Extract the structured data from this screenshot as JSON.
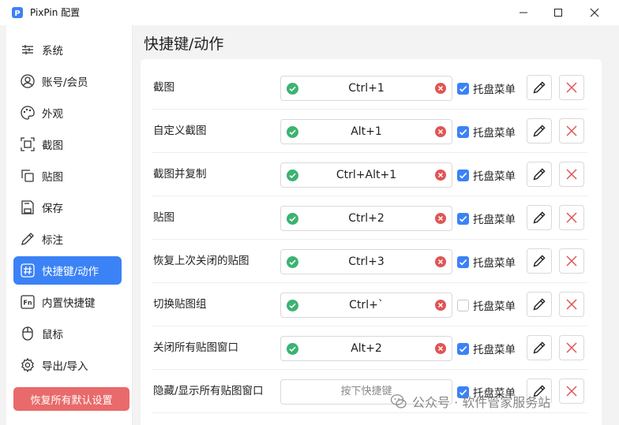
{
  "window": {
    "title": "PixPin 配置"
  },
  "page": {
    "title": "快捷键/动作"
  },
  "sidebar": {
    "items": [
      {
        "label": "系统",
        "icon": "sliders-icon",
        "active": false
      },
      {
        "label": "账号/会员",
        "icon": "user-icon",
        "active": false
      },
      {
        "label": "外观",
        "icon": "palette-icon",
        "active": false
      },
      {
        "label": "截图",
        "icon": "screenshot-icon",
        "active": false
      },
      {
        "label": "贴图",
        "icon": "pin-image-icon",
        "active": false
      },
      {
        "label": "保存",
        "icon": "save-icon",
        "active": false
      },
      {
        "label": "标注",
        "icon": "pencil-icon",
        "active": false
      },
      {
        "label": "快捷键/动作",
        "icon": "hash-icon",
        "active": true
      },
      {
        "label": "内置快捷键",
        "icon": "fn-key-icon",
        "active": false
      },
      {
        "label": "鼠标",
        "icon": "mouse-icon",
        "active": false
      },
      {
        "label": "导出/导入",
        "icon": "gear-icon",
        "active": false
      }
    ],
    "reset_button": "恢复所有默认设置"
  },
  "shortcuts": [
    {
      "name": "截图",
      "key": "Ctrl+1",
      "set": true,
      "tray_label": "托盘菜单",
      "tray": true
    },
    {
      "name": "自定义截图",
      "key": "Alt+1",
      "set": true,
      "tray_label": "托盘菜单",
      "tray": true
    },
    {
      "name": "截图并复制",
      "key": "Ctrl+Alt+1",
      "set": true,
      "tray_label": "托盘菜单",
      "tray": true
    },
    {
      "name": "贴图",
      "key": "Ctrl+2",
      "set": true,
      "tray_label": "托盘菜单",
      "tray": true
    },
    {
      "name": "恢复上次关闭的贴图",
      "key": "Ctrl+3",
      "set": true,
      "tray_label": "托盘菜单",
      "tray": true
    },
    {
      "name": "切换贴图组",
      "key": "Ctrl+`",
      "set": true,
      "tray_label": "托盘菜单",
      "tray": false
    },
    {
      "name": "关闭所有贴图窗口",
      "key": "Alt+2",
      "set": true,
      "tray_label": "托盘菜单",
      "tray": true
    },
    {
      "name": "隐藏/显示所有贴图窗口",
      "key": "",
      "placeholder": "按下快捷键",
      "set": false,
      "tray_label": "托盘菜单",
      "tray": true
    }
  ],
  "watermark": {
    "text": "公众号 · 软件管家服务站"
  },
  "colors": {
    "accent": "#3b82f6",
    "ok": "#3cb371",
    "clear": "#e05555",
    "reset": "#e96a6a",
    "delete": "#e05555"
  }
}
